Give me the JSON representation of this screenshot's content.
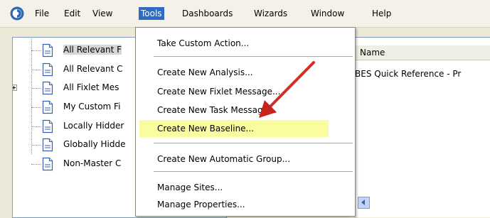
{
  "menubar": {
    "items": [
      {
        "label": "File"
      },
      {
        "label": "Edit"
      },
      {
        "label": "View"
      },
      {
        "label": "Tools"
      },
      {
        "label": "Dashboards"
      },
      {
        "label": "Wizards"
      },
      {
        "label": "Window"
      },
      {
        "label": "Help"
      }
    ],
    "active": "Tools"
  },
  "tree": {
    "items": [
      {
        "label": "All Relevant F",
        "selected": true
      },
      {
        "label": "All Relevant C"
      },
      {
        "label": "All Fixlet Mes",
        "expandable": true
      },
      {
        "label": "My Custom Fi"
      },
      {
        "label": "Locally Hidder"
      },
      {
        "label": "Globally Hidde"
      },
      {
        "label": "Non-Master C"
      }
    ]
  },
  "content": {
    "column_header": "Name",
    "rows": [
      "BES Quick Reference - Pr"
    ]
  },
  "tools_menu": {
    "items": [
      {
        "label": "Take Custom Action..."
      },
      {
        "label": "Create New Analysis..."
      },
      {
        "label": "Create New Fixlet Message..."
      },
      {
        "label": "Create New Task Message..."
      },
      {
        "label": "Create New Baseline...",
        "highlighted": true
      },
      {
        "label": "Create New Automatic Group..."
      },
      {
        "label": "Manage Sites..."
      },
      {
        "label": "Manage Properties..."
      }
    ]
  },
  "colors": {
    "menu_highlight": "#316ac5",
    "item_highlight": "#fbfba0",
    "annotation_arrow": "#d42a1f"
  }
}
